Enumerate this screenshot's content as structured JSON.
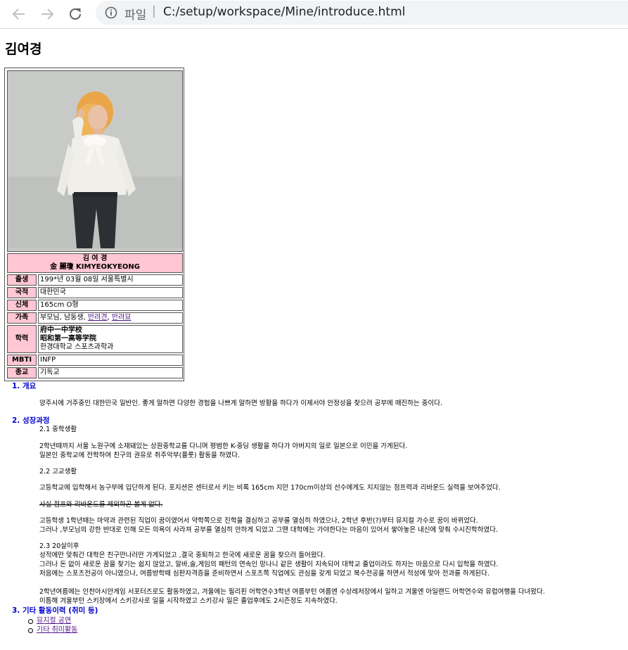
{
  "browser": {
    "scheme_label": "파일",
    "separator": "|",
    "url": "C:/setup/workspace/Mine/introduce.html"
  },
  "profile": {
    "name_heading": "김여경",
    "name_korean": "김 여 경",
    "name_hanja_roman": "金 麗瓊 KIMYEOKYEONG",
    "rows": [
      {
        "label": "출생",
        "value": "199*년 03월 08일 서울특별시"
      },
      {
        "label": "국적",
        "value": "대한민국"
      },
      {
        "label": "신체",
        "value": "165cm O형"
      },
      {
        "label": "가족",
        "value_prefix": "부모님, 남동생, ",
        "link1": "반려견",
        "link_sep": ", ",
        "link2": "반려묘"
      },
      {
        "label": "학력",
        "lines": [
          "府中一中学校",
          "昭和第一高等学院",
          "한경대학교 스포츠과학과"
        ]
      },
      {
        "label": "MBTI",
        "value": "INFP"
      },
      {
        "label": "종교",
        "value": "기독교"
      }
    ]
  },
  "sections": {
    "overview": {
      "heading": "1. 개요",
      "text": "양주시에 거주중인 대한민국 일반인. 좋게 말하면 다양한 경험을 나쁘게 말하면 방황을 하다가 이제서야 안정성을 찾으려 공부에 매진하는 중이다."
    },
    "growth": {
      "heading": "2. 성장과정",
      "middle_title": "2.1 중학생활",
      "middle_lines": [
        "2학년때까지 서울 노원구에 소재돼있는 상원중학교를 다니며 평범한 K-중딩 생활을 하다가 아버지의 일로 일본으로 이민을 가게된다.",
        "일본인 중학교에 전학하여 친구의 권유로 취주악부(플룻) 활동을 하였다."
      ],
      "high_title": "2.2 고교생활",
      "high_line1": "고등학교에 입학해서 농구부에 입단하게 된다. 포지션은 센터로서 키는 비록 165cm 지만 170cm이상의 선수에게도 지지않는 점프력과 리바운드 실력을 보여주었다.",
      "high_strike": "사실 점프와 리바운드를 제외하곤 볼게 없다.",
      "high_lines2": [
        "고등학생 1학년때는 마약과 관련된 직업이 꿈이였어서 약학쪽으로 진학을 결심하고 공부를 열심히 하였으나, 2학년 후반(?)부터 뮤지컬 가수로 꿈이 바뀌었다.",
        "그러나 ,부모님의 강한 반대로 인해 모든 의욕이 사라져 공부를 열심히 안하게 되었고 그땐 대학에는 가야한다는 마음이 있어서 쌓아놓은 내신에 맞춰 수시진학하였다."
      ],
      "twenties_title": "2.3 20살이후",
      "twenties_lines": [
        "성적에만 맞춰간 대학은 친구만나러만 가게되었고 ,결국 중퇴하고 한국에 새로운 꿈을 찾으러 들어왔다.",
        "그러나 돈 없이 새로운 꿈을 찾기는 쉽지 않았고, 알바,술,게임의 패턴의 연속인 망나니 같은 생활이 지속되어 대학교 졸업이라도 하자는 마음으로 다시 입학을 하였다.",
        "처음에는 스포츠전공이 아니였으나, 여름방학때 심판자격증을 준비하면서 스포츠쪽 직업에도 관심을 갖게 되었고 복수전공을 하면서 적성에 맞아 전과를 하게된다."
      ],
      "twenties_lines2": [
        "2학년여름에는 인천아시안게임 서포터즈로도 활동하였고, 겨울에는 필리핀 어학연수3학년 여름부턴 여름엔 수상레저장에서 일하고 겨울엔 아일랜드 어학연수와 유럽여행을 다녀왔다.",
        "이틈해 겨울부턴 스키장에서 스키강사로 일을 시작하였고 스키강사 일은 졸업후에도 2시즌정도 지속하였다."
      ]
    },
    "activities": {
      "heading": "3. 기타 활동이력 (취미 등)",
      "items": [
        "뮤지컬 공연",
        "기타 취미활동"
      ]
    }
  },
  "colors": {
    "label_bg": "#ffc6d3",
    "section_heading": "#0000cc",
    "visited_link": "#551a8b"
  },
  "icons": [
    "back-arrow-icon",
    "forward-arrow-icon",
    "reload-icon",
    "info-icon"
  ]
}
